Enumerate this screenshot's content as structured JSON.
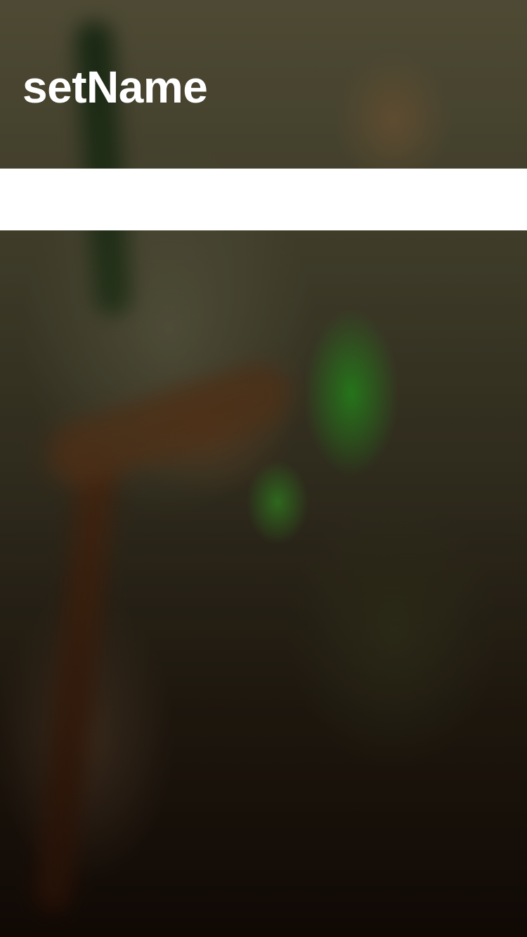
{
  "header": {
    "title": "setName"
  },
  "name_input": {
    "value": "",
    "placeholder": ""
  },
  "background": {
    "icon": "blurred-character-artwork"
  }
}
